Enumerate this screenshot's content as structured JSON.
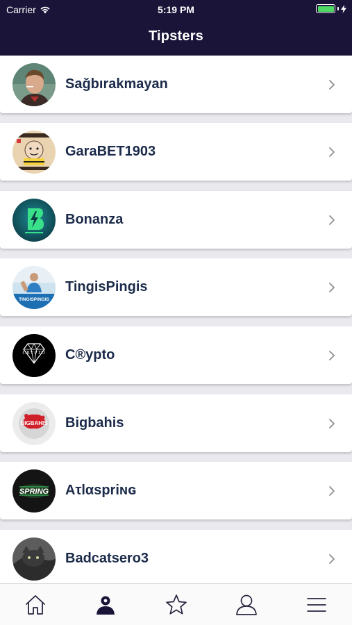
{
  "status_bar": {
    "carrier": "Carrier",
    "time": "5:19 PM"
  },
  "nav": {
    "title": "Tipsters"
  },
  "tipsters": [
    {
      "name": "Sağbırakmayan",
      "avatar_icon": "person-photo-icon"
    },
    {
      "name": "GaraBET1903",
      "avatar_icon": "cartoon-face-icon"
    },
    {
      "name": "Bonanza",
      "avatar_icon": "bonanza-logo-icon"
    },
    {
      "name": "TingisPingis",
      "avatar_icon": "tingispingis-logo-icon"
    },
    {
      "name": "C®ypto",
      "avatar_icon": "crypto-logo-icon"
    },
    {
      "name": "Bigbahis",
      "avatar_icon": "bigbahis-logo-icon"
    },
    {
      "name": "Aτlαspriɴɢ",
      "avatar_icon": "spring-logo-icon"
    },
    {
      "name": "Badcatsero3",
      "avatar_icon": "cat-photo-icon"
    }
  ],
  "avatar_text": {
    "crypto": "CRYPTO",
    "spring": "SPRING",
    "bigbahis": "BIGBAHIS",
    "tingis": "TINGISPINGIS"
  },
  "tabs": [
    {
      "name": "home",
      "icon": "home-icon",
      "active": false
    },
    {
      "name": "tipsters",
      "icon": "person-filled-icon",
      "active": true
    },
    {
      "name": "favorites",
      "icon": "star-icon",
      "active": false
    },
    {
      "name": "profile",
      "icon": "person-outline-icon",
      "active": false
    },
    {
      "name": "menu",
      "icon": "menu-icon",
      "active": false
    }
  ],
  "colors": {
    "header_bg": "#1a1438",
    "name_text": "#1c2b4a",
    "battery": "#4cd964",
    "chevron": "#8e8e93",
    "tab_icon": "#2a2540"
  }
}
